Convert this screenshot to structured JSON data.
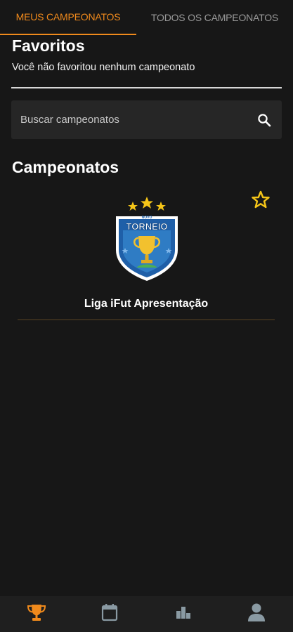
{
  "tabs": [
    {
      "label": "MEUS CAMPEONATOS",
      "active": true
    },
    {
      "label": "TODOS OS CAMPEONATOS",
      "active": false
    }
  ],
  "favorites": {
    "title": "Favoritos",
    "empty_message": "Você não favoritou nenhum campeonato"
  },
  "search": {
    "placeholder": "Buscar campeonatos",
    "value": ""
  },
  "championships": {
    "title": "Campeonatos",
    "items": [
      {
        "name": "Liga iFut Apresentação",
        "logo_text_top": "NOVO",
        "logo_text_main": "TORNEIO",
        "favorited": false
      }
    ]
  },
  "bottom_nav": [
    {
      "icon": "trophy-icon",
      "active": true
    },
    {
      "icon": "calendar-icon",
      "active": false
    },
    {
      "icon": "ranking-icon",
      "active": false
    },
    {
      "icon": "profile-icon",
      "active": false
    }
  ],
  "colors": {
    "accent": "#f08a1c",
    "background": "#171717",
    "search_bg": "#262626",
    "star": "#f5c518",
    "inactive_icon": "#8a9aa3"
  }
}
